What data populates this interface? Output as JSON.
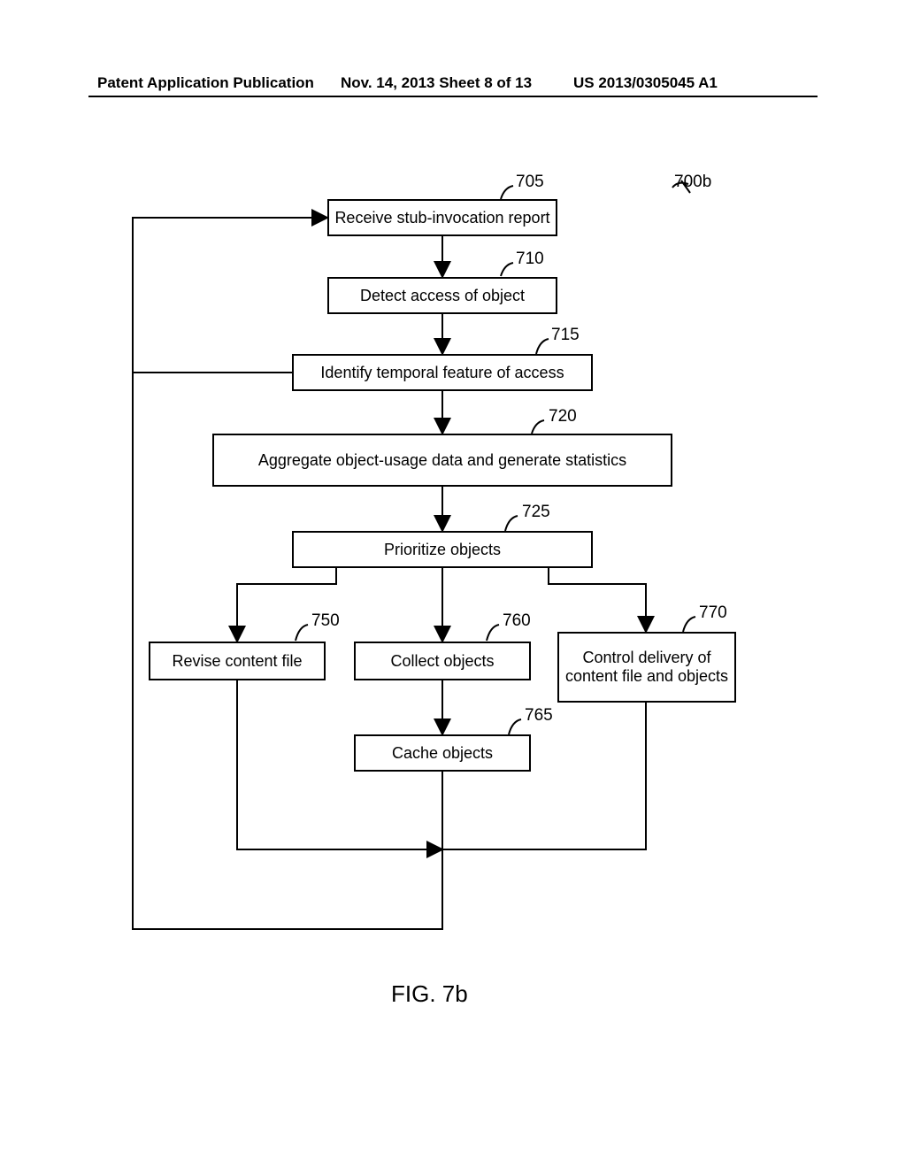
{
  "header": {
    "left": "Patent Application Publication",
    "center": "Nov. 14, 2013  Sheet 8 of 13",
    "right": "US 2013/0305045 A1"
  },
  "figure_label": "FIG. 7b",
  "diagram_ref": "700b",
  "nodes": {
    "n705": {
      "label": "Receive stub-invocation report",
      "ref": "705"
    },
    "n710": {
      "label": "Detect access of object",
      "ref": "710"
    },
    "n715": {
      "label": "Identify temporal feature of access",
      "ref": "715"
    },
    "n720": {
      "label": "Aggregate object-usage data and generate statistics",
      "ref": "720"
    },
    "n725": {
      "label": "Prioritize objects",
      "ref": "725"
    },
    "n750": {
      "label": "Revise content file",
      "ref": "750"
    },
    "n760": {
      "label": "Collect objects",
      "ref": "760"
    },
    "n765": {
      "label": "Cache objects",
      "ref": "765"
    },
    "n770": {
      "label": "Control delivery of content file and objects",
      "ref": "770"
    }
  }
}
